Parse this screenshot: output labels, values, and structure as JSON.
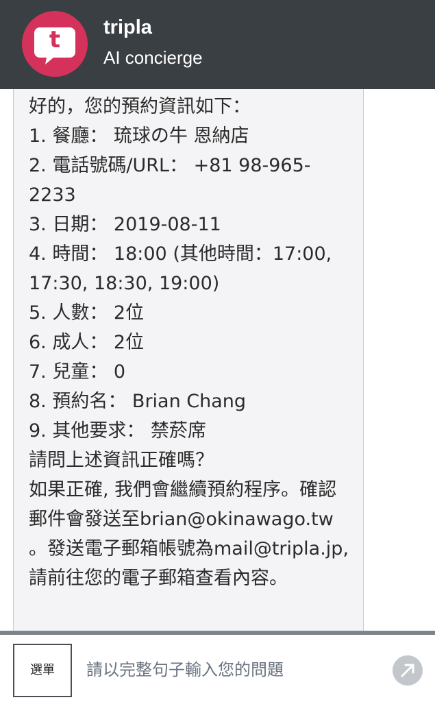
{
  "header": {
    "brand": "tripla",
    "subtitle": "AI concierge",
    "logo_letter": "t",
    "accent_color": "#d4325a",
    "background_color": "#3a3f44"
  },
  "chat": {
    "message_lines": [
      "好的，您的預約資訊如下：",
      "1. 餐廳： 琉球の牛 恩納店",
      "2. 電話號碼/URL： +81 98-965-2233",
      "3. 日期： 2019-08-11",
      "4. 時間： 18:00 (其他時間：17:00, 17:30, 18:30, 19:00)",
      "5. 人數： 2位",
      "6. 成人： 2位",
      "7. 兒童： 0",
      "8. 預約名： Brian Chang",
      "9. 其他要求： 禁菸席",
      "請問上述資訊正確嗎？",
      "如果正確, 我們會繼續預約程序。確認郵件會發送至brian@okinawago.tw 。發送電子郵箱帳號為mail@tripla.jp, 請前往您的電子郵箱查看內容。"
    ]
  },
  "footer": {
    "menu_label": "選單",
    "input_placeholder": "請以完整句子輸入您的問題",
    "send_icon": "arrow-up-right-icon"
  }
}
